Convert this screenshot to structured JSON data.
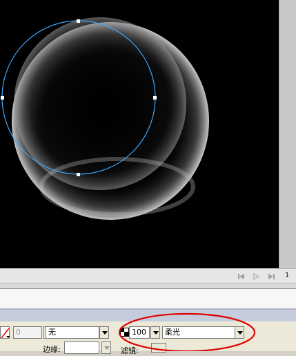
{
  "timeline": {
    "frame_number": "1",
    "controls": [
      "first-frame-icon",
      "play-icon",
      "last-frame-icon"
    ]
  },
  "properties": {
    "stroke_value": "0",
    "stroke_style": "无",
    "alpha_value": "100",
    "blend_mode": "柔光",
    "edge_label": "边缘:",
    "filter_label": "滤镜:"
  },
  "colors": {
    "selection_circle": "#3fa9ff",
    "annotation_ellipse": "#e00000",
    "stage_background": "#000000"
  }
}
